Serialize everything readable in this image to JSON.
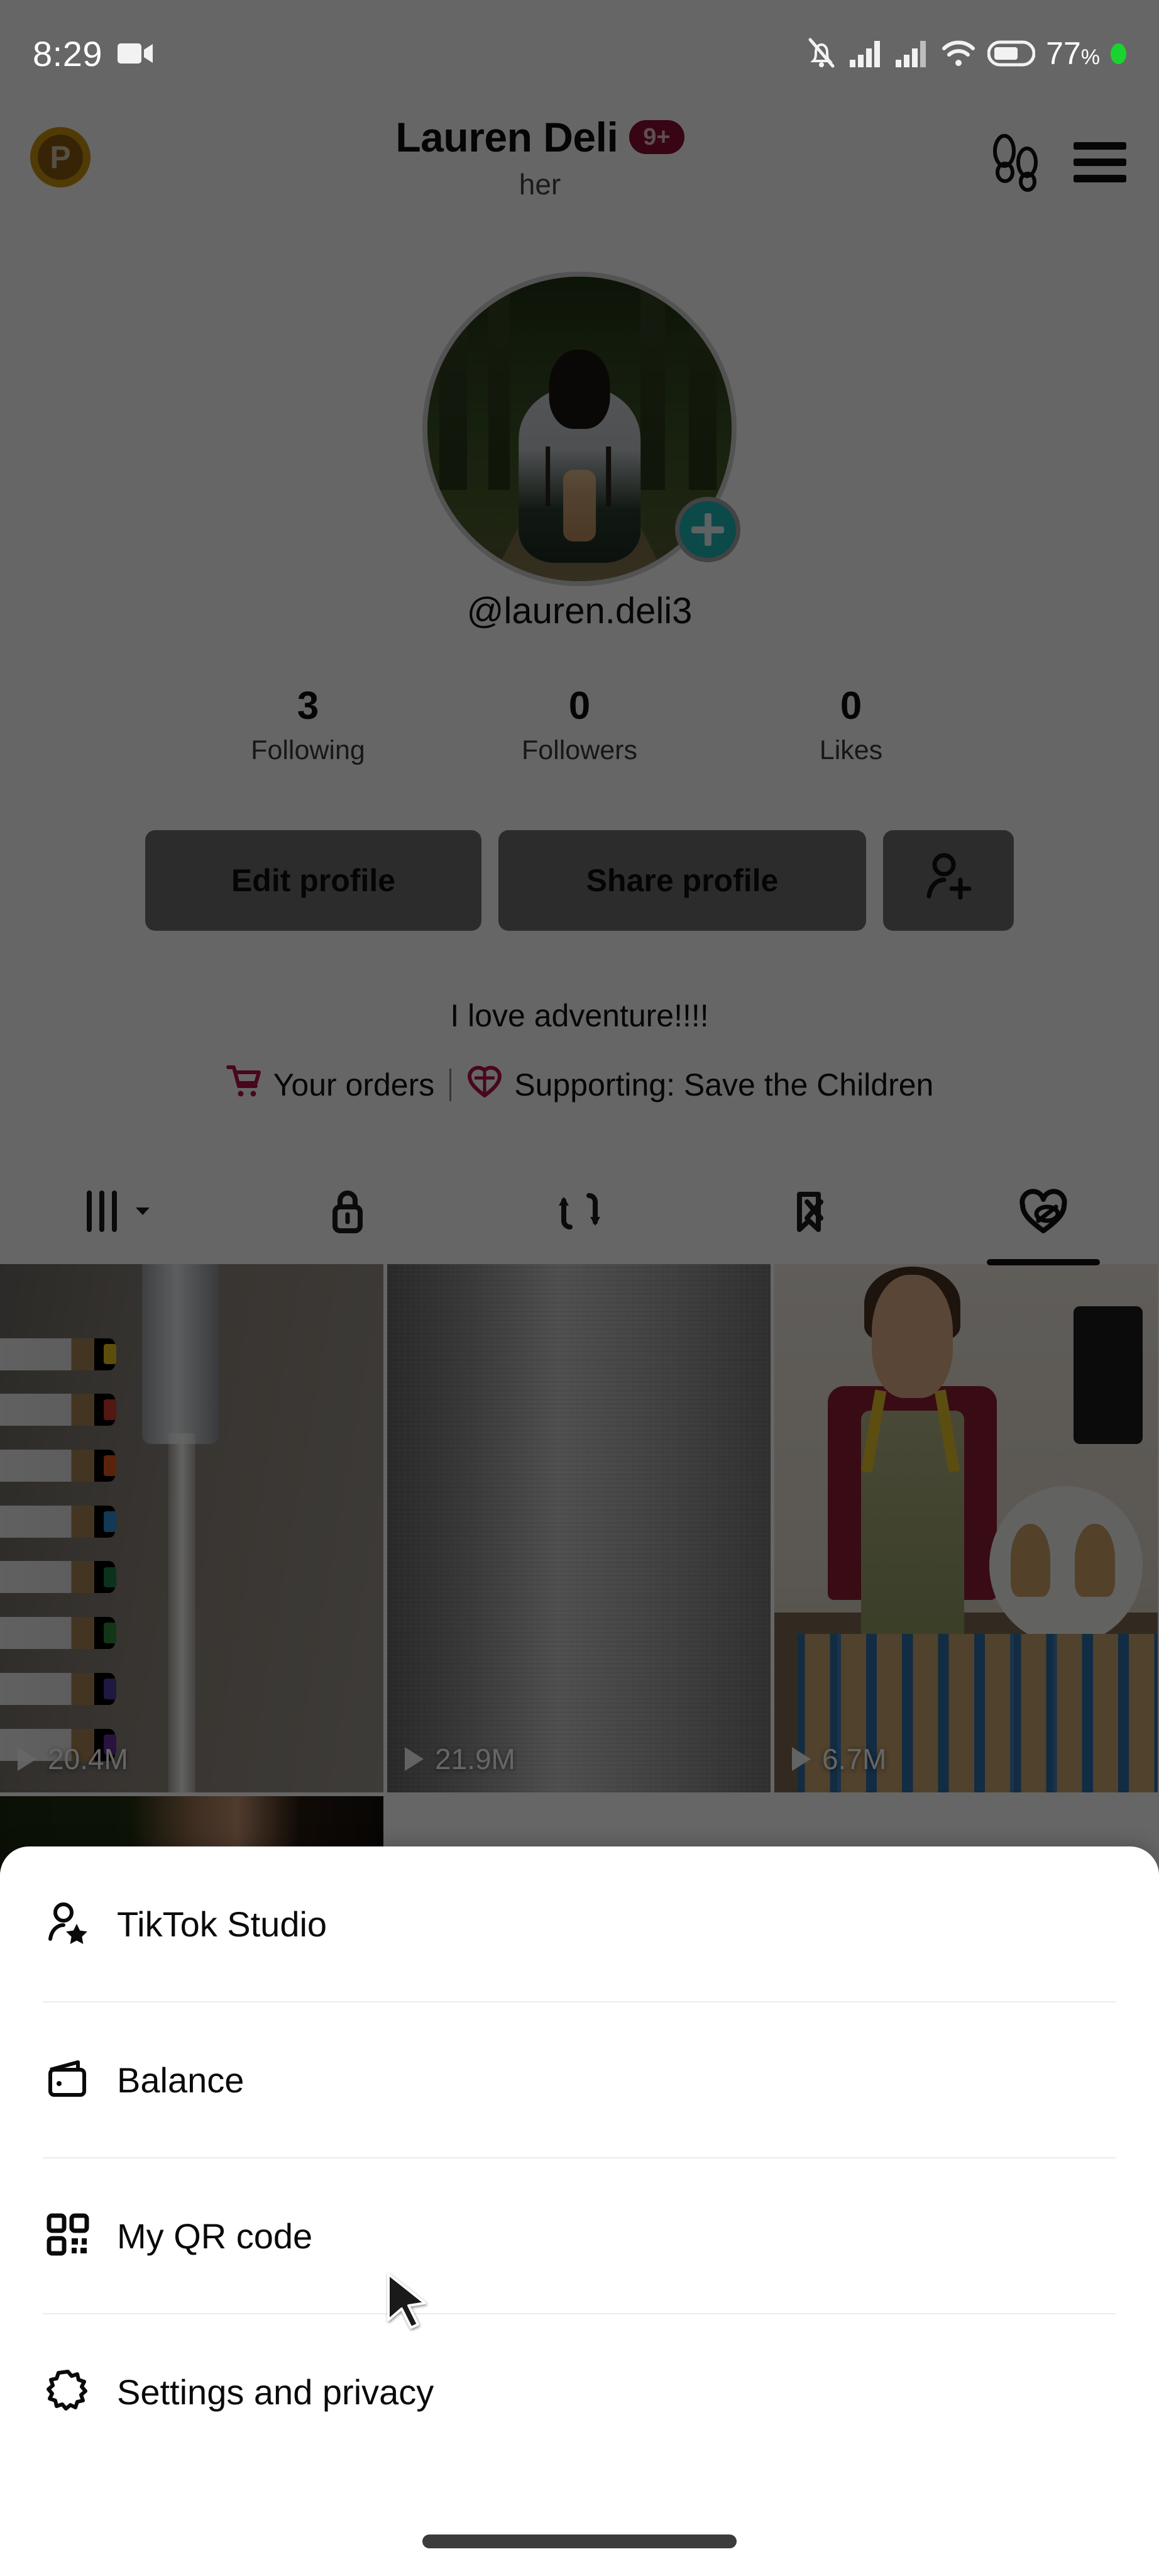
{
  "status_bar": {
    "time": "8:29",
    "video_icon": "video-camera-icon",
    "mute_icon": "bell-off-icon",
    "signal1_icon": "cell-signal-icon",
    "signal2_icon": "cell-signal-icon",
    "wifi_icon": "wifi-icon",
    "battery_icon": "battery-icon",
    "battery_percent": "77",
    "percent_symbol": "%",
    "recording_dot": "green-status-dot"
  },
  "header": {
    "coin_letter": "P",
    "coin_icon": "points-coin-icon",
    "display_name": "Lauren Deli",
    "notification_badge": "9+",
    "pronoun": "her",
    "footprints_icon": "footprints-icon",
    "menu_icon": "hamburger-menu-icon"
  },
  "profile": {
    "avatar_alt": "hiker-with-backpack-in-forest",
    "add_icon": "plus-icon",
    "handle": "@lauren.deli3",
    "stats": [
      {
        "value": "3",
        "label": "Following"
      },
      {
        "value": "0",
        "label": "Followers"
      },
      {
        "value": "0",
        "label": "Likes"
      }
    ],
    "buttons": {
      "edit": "Edit profile",
      "share": "Share profile",
      "add_friend_icon": "person-add-icon"
    },
    "bio": "I love adventure!!!!",
    "links": [
      {
        "icon": "shopping-cart-icon",
        "label": "Your orders"
      },
      {
        "icon": "charity-heart-icon",
        "label": "Supporting: Save the Children"
      }
    ],
    "accent_crimson": "#c2185b"
  },
  "tabs": [
    {
      "name": "posts-grid",
      "icon": "grid-bars-icon",
      "has_chevron": true,
      "active": false
    },
    {
      "name": "private",
      "icon": "lock-icon",
      "has_chevron": false,
      "active": false
    },
    {
      "name": "reposts",
      "icon": "repost-icon",
      "has_chevron": false,
      "active": false
    },
    {
      "name": "saved",
      "icon": "bookmark-off-icon",
      "has_chevron": false,
      "active": false
    },
    {
      "name": "liked",
      "icon": "heart-hidden-icon",
      "has_chevron": false,
      "active": true
    }
  ],
  "video_grid": {
    "play_icon": "play-triangle-icon",
    "rows": [
      [
        {
          "thumb": "faucet-water-markers",
          "views": "20.4M"
        },
        {
          "thumb": "gray-concrete-texture",
          "views": "21.9M"
        },
        {
          "thumb": "woman-baking-muffins",
          "views": "6.7M"
        }
      ],
      [
        {
          "thumb": "dark-foliage-clip",
          "views": ""
        }
      ]
    ]
  },
  "sheet": {
    "items": [
      {
        "icon": "person-star-icon",
        "label": "TikTok Studio"
      },
      {
        "icon": "wallet-icon",
        "label": "Balance"
      },
      {
        "icon": "qr-code-icon",
        "label": "My QR code"
      },
      {
        "icon": "gear-icon",
        "label": "Settings and privacy"
      }
    ],
    "home_indicator": "home-indicator-bar"
  },
  "cursor": {
    "icon": "mouse-pointer-icon"
  }
}
